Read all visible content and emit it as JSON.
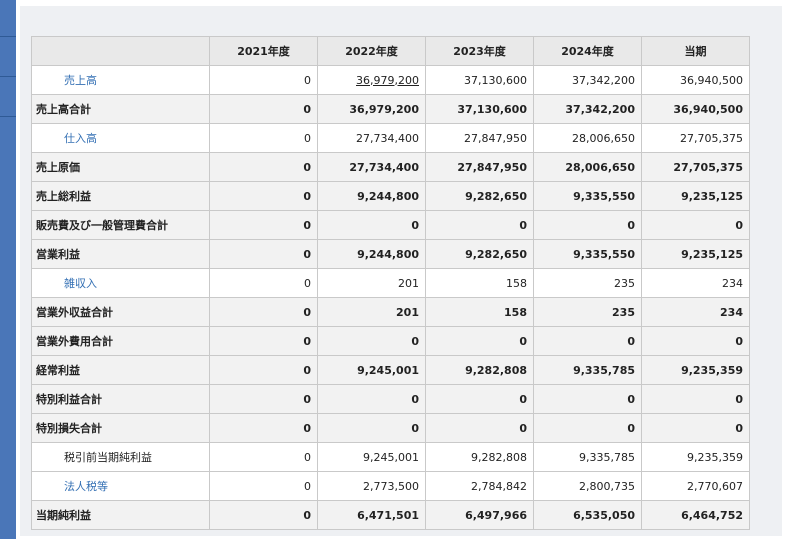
{
  "table": {
    "columns": [
      "",
      "2021年度",
      "2022年度",
      "2023年度",
      "2024年度",
      "当期"
    ],
    "rows": [
      {
        "label": "売上高",
        "kind": "detail",
        "style": "link",
        "values": [
          "0",
          "36,979,200",
          "37,130,600",
          "37,342,200",
          "36,940,500"
        ]
      },
      {
        "label": "売上高合計",
        "kind": "total",
        "style": "plain",
        "values": [
          "0",
          "36,979,200",
          "37,130,600",
          "37,342,200",
          "36,940,500"
        ]
      },
      {
        "label": "仕入高",
        "kind": "detail",
        "style": "link",
        "values": [
          "0",
          "27,734,400",
          "27,847,950",
          "28,006,650",
          "27,705,375"
        ]
      },
      {
        "label": "売上原価",
        "kind": "total",
        "style": "plain",
        "values": [
          "0",
          "27,734,400",
          "27,847,950",
          "28,006,650",
          "27,705,375"
        ]
      },
      {
        "label": "売上総利益",
        "kind": "total",
        "style": "plain",
        "values": [
          "0",
          "9,244,800",
          "9,282,650",
          "9,335,550",
          "9,235,125"
        ]
      },
      {
        "label": "販売費及び一般管理費合計",
        "kind": "total",
        "style": "plain",
        "values": [
          "0",
          "0",
          "0",
          "0",
          "0"
        ]
      },
      {
        "label": "営業利益",
        "kind": "total",
        "style": "plain",
        "values": [
          "0",
          "9,244,800",
          "9,282,650",
          "9,335,550",
          "9,235,125"
        ]
      },
      {
        "label": "雑収入",
        "kind": "detail",
        "style": "link",
        "values": [
          "0",
          "201",
          "158",
          "235",
          "234"
        ]
      },
      {
        "label": "営業外収益合計",
        "kind": "total",
        "style": "plain",
        "values": [
          "0",
          "201",
          "158",
          "235",
          "234"
        ]
      },
      {
        "label": "営業外費用合計",
        "kind": "total",
        "style": "plain",
        "values": [
          "0",
          "0",
          "0",
          "0",
          "0"
        ]
      },
      {
        "label": "経常利益",
        "kind": "total",
        "style": "plain",
        "values": [
          "0",
          "9,245,001",
          "9,282,808",
          "9,335,785",
          "9,235,359"
        ]
      },
      {
        "label": "特別利益合計",
        "kind": "total",
        "style": "plain",
        "values": [
          "0",
          "0",
          "0",
          "0",
          "0"
        ]
      },
      {
        "label": "特別損失合計",
        "kind": "total",
        "style": "plain",
        "values": [
          "0",
          "0",
          "0",
          "0",
          "0"
        ]
      },
      {
        "label": "税引前当期純利益",
        "kind": "detail",
        "style": "plain",
        "values": [
          "0",
          "9,245,001",
          "9,282,808",
          "9,335,785",
          "9,235,359"
        ]
      },
      {
        "label": "法人税等",
        "kind": "detail",
        "style": "link",
        "values": [
          "0",
          "2,773,500",
          "2,784,842",
          "2,800,735",
          "2,770,607"
        ]
      },
      {
        "label": "当期純利益",
        "kind": "total",
        "style": "plain",
        "values": [
          "0",
          "6,471,501",
          "6,497,966",
          "6,535,050",
          "6,464,752"
        ]
      }
    ]
  },
  "colors": {
    "rail": "#4a76b8",
    "link": "#3470b4",
    "header_bg": "#e9e9e9",
    "total_bg": "#f2f2f2"
  }
}
